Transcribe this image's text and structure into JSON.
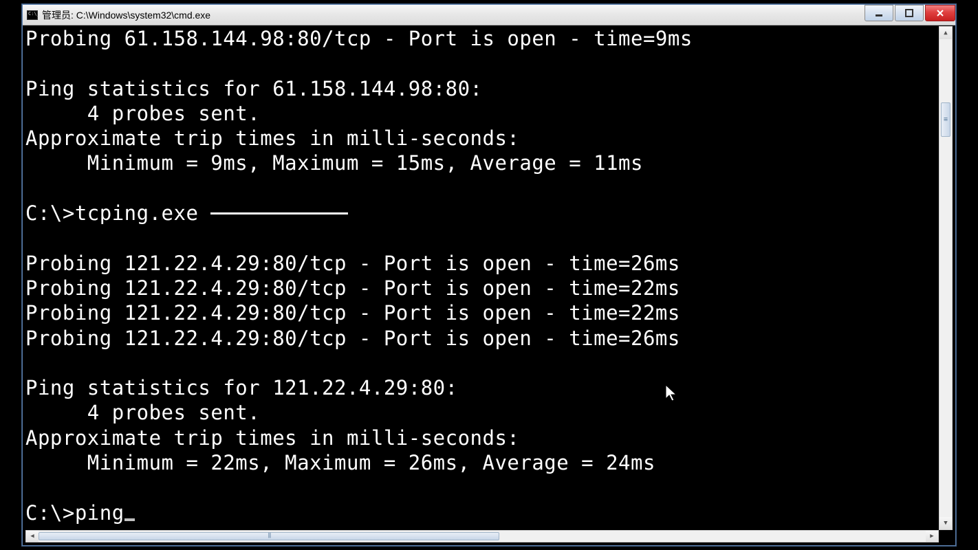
{
  "titlebar": {
    "text": "管理员: C:\\Windows\\system32\\cmd.exe"
  },
  "terminal": {
    "line1": "Probing 61.158.144.98:80/tcp - Port is open - time=9ms",
    "blank1": "",
    "stats1_header": "Ping statistics for 61.158.144.98:80:",
    "stats1_probes": "     4 probes sent.",
    "stats1_approx": "Approximate trip times in milli-seconds:",
    "stats1_times": "     Minimum = 9ms, Maximum = 15ms, Average = 11ms",
    "blank2": "",
    "prompt1_pre": "C:\\>tcping.exe ",
    "blank3": "",
    "probe2_1": "Probing 121.22.4.29:80/tcp - Port is open - time=26ms",
    "probe2_2": "Probing 121.22.4.29:80/tcp - Port is open - time=22ms",
    "probe2_3": "Probing 121.22.4.29:80/tcp - Port is open - time=22ms",
    "probe2_4": "Probing 121.22.4.29:80/tcp - Port is open - time=26ms",
    "blank4": "",
    "stats2_header": "Ping statistics for 121.22.4.29:80:",
    "stats2_probes": "     4 probes sent.",
    "stats2_approx": "Approximate trip times in milli-seconds:",
    "stats2_times": "     Minimum = 22ms, Maximum = 26ms, Average = 24ms",
    "blank5": "",
    "prompt2": "C:\\>ping"
  }
}
